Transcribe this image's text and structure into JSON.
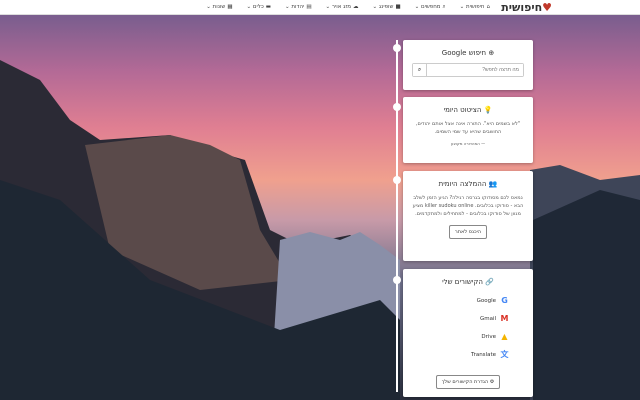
{
  "logo": "חיפושית",
  "nav": [
    {
      "icon": "home-icon",
      "g": "⌂",
      "label": "חיפושית"
    },
    {
      "icon": "search-icon",
      "g": "⌕",
      "label": "מחפשים"
    },
    {
      "icon": "shopping-bag-icon",
      "g": "■",
      "label": "שופינג"
    },
    {
      "icon": "cloud-icon",
      "g": "☁",
      "label": "מזג אויר"
    },
    {
      "icon": "book-icon",
      "g": "▤",
      "label": "יהדות"
    },
    {
      "icon": "toolbox-icon",
      "g": "▬",
      "label": "כלים"
    },
    {
      "icon": "grid-icon",
      "g": "▦",
      "label": "שונות"
    }
  ],
  "google": {
    "title": "חיפוש Google",
    "placeholder": "מה תרצה לחפש?"
  },
  "quote": {
    "title": "הציטוט היומי",
    "text": "\"לא בשמים היא\". התורה אינה אצל אותם יהודים, החושבים שהיא עד שמי השמים.",
    "author": "— המהדורה מקוצע"
  },
  "recommend": {
    "title": "ההמלצה היומית",
    "text": "נמאס לכם מסודוקו בגרסה רגילה? הגיע הזמן לשלב הבא - סודוקו בכלובים. killer sudoku online מציע מגוון של סודוקו בכלובים - למתחילים ולמתקדמים.",
    "button": "היכנס לאתר"
  },
  "links": {
    "title": "הקישורים שלי",
    "items": [
      {
        "label": "Google",
        "color": "#4285f4",
        "g": "G"
      },
      {
        "label": "Gmail",
        "color": "#d93025",
        "g": "M"
      },
      {
        "label": "Drive",
        "color": "#f4b400",
        "g": "▲"
      },
      {
        "label": "Translate",
        "color": "#4285f4",
        "g": "文"
      }
    ],
    "button": "הגדרת הקישורים שלך"
  }
}
